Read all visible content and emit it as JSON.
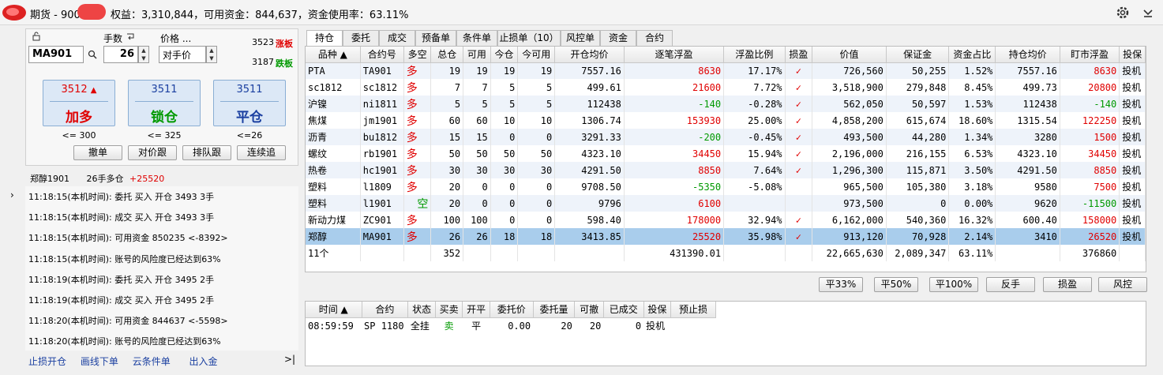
{
  "title": {
    "account": "期货 - 900",
    "summary": "权益：3,310,844，可用资金：844,637，资金使用率：63.11%"
  },
  "order_panel": {
    "qty_label": "手数",
    "price_label": "价格 ...",
    "contract": "MA901",
    "qty": "26",
    "price_type": "对手价",
    "limit_up": "3523",
    "limit_up_label": "涨板",
    "limit_down": "3187",
    "limit_down_label": "跌板",
    "buttons": [
      {
        "price": "3512",
        "name": "加多",
        "limit": "<= 300"
      },
      {
        "price": "3511",
        "name": "锁仓",
        "limit": "<= 325"
      },
      {
        "price": "3511",
        "name": "平仓",
        "limit": "<=26"
      }
    ],
    "small_buttons": [
      "撤单",
      "对价跟",
      "排队跟",
      "连续追"
    ]
  },
  "position_summary": {
    "contract": "郑醇1901",
    "qty": "26手多仓",
    "profit": "+25520"
  },
  "log": [
    "11:18:15(本机时间): 委托  买入  开仓  3493  3手",
    "11:18:15(本机时间): 成交  买入  开仓  3493  3手",
    "11:18:15(本机时间): 可用资金 850235 <-8392>",
    "11:18:15(本机时间): 账号的风险度已经达到63%",
    "11:18:19(本机时间): 委托  买入  开仓  3495  2手",
    "11:18:19(本机时间): 成交  买入  开仓  3495  2手",
    "11:18:20(本机时间): 可用资金 844637 <-5598>",
    "11:18:20(本机时间): 账号的风险度已经达到63%"
  ],
  "bottom_links": [
    "止损开仓",
    "画线下单",
    "云条件单",
    "出入金"
  ],
  "tabs": [
    "持仓",
    "委托",
    "成交",
    "预备单",
    "条件单",
    "止损单（10）",
    "风控单",
    "资金",
    "合约"
  ],
  "positions": {
    "headers": [
      "品种 ▲",
      "合约号",
      "多空",
      "总仓",
      "可用",
      "今仓",
      "今可用",
      "开仓均价",
      "逐笔浮盈",
      "浮盈比例",
      "损盈",
      "价值",
      "保证金",
      "资金占比",
      "持仓均价",
      "盯市浮盈",
      "投保"
    ],
    "rows": [
      [
        "PTA",
        "TA901",
        "多",
        "19",
        "19",
        "19",
        "19",
        "7557.16",
        "8630",
        "17.17%",
        "✓",
        "726,560",
        "50,255",
        "1.52%",
        "7557.16",
        "8630",
        "投机"
      ],
      [
        "sc1812",
        "sc1812",
        "多",
        "7",
        "7",
        "5",
        "5",
        "499.61",
        "21600",
        "7.72%",
        "✓",
        "3,518,900",
        "279,848",
        "8.45%",
        "499.73",
        "20800",
        "投机"
      ],
      [
        "沪镍",
        "ni1811",
        "多",
        "5",
        "5",
        "5",
        "5",
        "112438",
        "-140",
        "-0.28%",
        "✓",
        "562,050",
        "50,597",
        "1.53%",
        "112438",
        "-140",
        "投机"
      ],
      [
        "焦煤",
        "jm1901",
        "多",
        "60",
        "60",
        "10",
        "10",
        "1306.74",
        "153930",
        "25.00%",
        "✓",
        "4,858,200",
        "615,674",
        "18.60%",
        "1315.54",
        "122250",
        "投机"
      ],
      [
        "沥青",
        "bu1812",
        "多",
        "15",
        "15",
        "0",
        "0",
        "3291.33",
        "-200",
        "-0.45%",
        "✓",
        "493,500",
        "44,280",
        "1.34%",
        "3280",
        "1500",
        "投机"
      ],
      [
        "螺纹",
        "rb1901",
        "多",
        "50",
        "50",
        "50",
        "50",
        "4323.10",
        "34450",
        "15.94%",
        "✓",
        "2,196,000",
        "216,155",
        "6.53%",
        "4323.10",
        "34450",
        "投机"
      ],
      [
        "热卷",
        "hc1901",
        "多",
        "30",
        "30",
        "30",
        "30",
        "4291.50",
        "8850",
        "7.64%",
        "✓",
        "1,296,300",
        "115,871",
        "3.50%",
        "4291.50",
        "8850",
        "投机"
      ],
      [
        "塑料",
        "l1809",
        "多",
        "20",
        "0",
        "0",
        "0",
        "9708.50",
        "-5350",
        "-5.08%",
        "",
        "965,500",
        "105,380",
        "3.18%",
        "9580",
        "7500",
        "投机"
      ],
      [
        "塑料",
        "l1901",
        "空",
        "20",
        "0",
        "0",
        "0",
        "9796",
        "6100",
        "",
        "",
        "973,500",
        "0",
        "0.00%",
        "9620",
        "-11500",
        "投机"
      ],
      [
        "新动力煤",
        "ZC901",
        "多",
        "100",
        "100",
        "0",
        "0",
        "598.40",
        "178000",
        "32.94%",
        "✓",
        "6,162,000",
        "540,360",
        "16.32%",
        "600.40",
        "158000",
        "投机"
      ],
      [
        "郑醇",
        "MA901",
        "多",
        "26",
        "26",
        "18",
        "18",
        "3413.85",
        "25520",
        "35.98%",
        "✓",
        "913,120",
        "70,928",
        "2.14%",
        "3410",
        "26520",
        "投机"
      ]
    ],
    "total": [
      "11个",
      "",
      "",
      "352",
      "",
      "",
      "",
      "",
      "431390.01",
      "",
      "",
      "22,665,630",
      "2,089,347",
      "63.11%",
      "",
      "376860",
      ""
    ]
  },
  "action_buttons": [
    "平33%",
    "平50%",
    "平100%",
    "反手",
    "损盈",
    "风控"
  ],
  "orders": {
    "headers": [
      "时间 ▲",
      "合约",
      "状态",
      "买卖",
      "开平",
      "委托价",
      "委托量",
      "可撤",
      "已成交",
      "投保",
      "预止损"
    ],
    "rows": [
      [
        "08:59:59",
        "SP 1180",
        "全挂",
        "卖",
        "平",
        "0.00",
        "20",
        "20",
        "0",
        "投机",
        ""
      ]
    ]
  },
  "colors": {
    "profit": "#e00000",
    "loss": "#009900",
    "accent": "#1a3fa0",
    "selected": "#a9cdec"
  }
}
